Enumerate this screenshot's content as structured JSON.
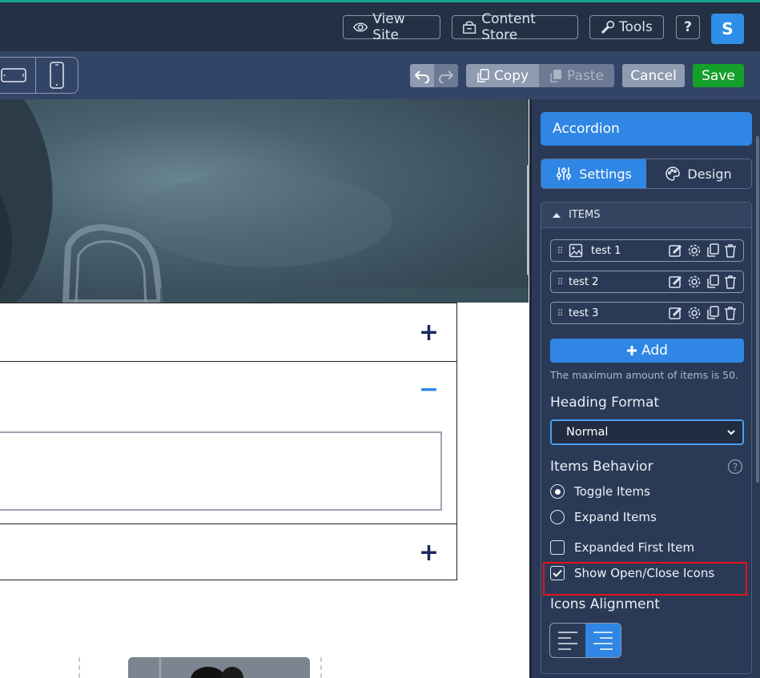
{
  "topbar": {
    "view_site": "View Site",
    "content_store": "Content Store",
    "tools": "Tools",
    "help": "?",
    "avatar_letter": "S"
  },
  "toolbar": {
    "copy": "Copy",
    "paste": "Paste",
    "cancel": "Cancel",
    "save": "Save"
  },
  "accordion": {
    "row1_icon": "+",
    "row2_icon": "−",
    "row3_icon": "+"
  },
  "panel": {
    "title": "Accordion",
    "tab_settings": "Settings",
    "tab_design": "Design",
    "items_heading": "ITEMS",
    "items": [
      {
        "label": "test 1",
        "has_image": true
      },
      {
        "label": "test 2",
        "has_image": false
      },
      {
        "label": "test 3",
        "has_image": false
      }
    ],
    "add_label": "Add",
    "max_hint": "The maximum amount of items is 50.",
    "heading_format_label": "Heading Format",
    "heading_format_value": "Normal",
    "items_behavior_label": "Items Behavior",
    "toggle_items": "Toggle Items",
    "expand_items": "Expand Items",
    "expanded_first_item": "Expanded First Item",
    "show_icons": "Show Open/Close Icons",
    "icons_alignment_label": "Icons Alignment"
  },
  "colors": {
    "accent": "#2f86e4",
    "save": "#14a02a",
    "highlight": "#e3131b"
  }
}
